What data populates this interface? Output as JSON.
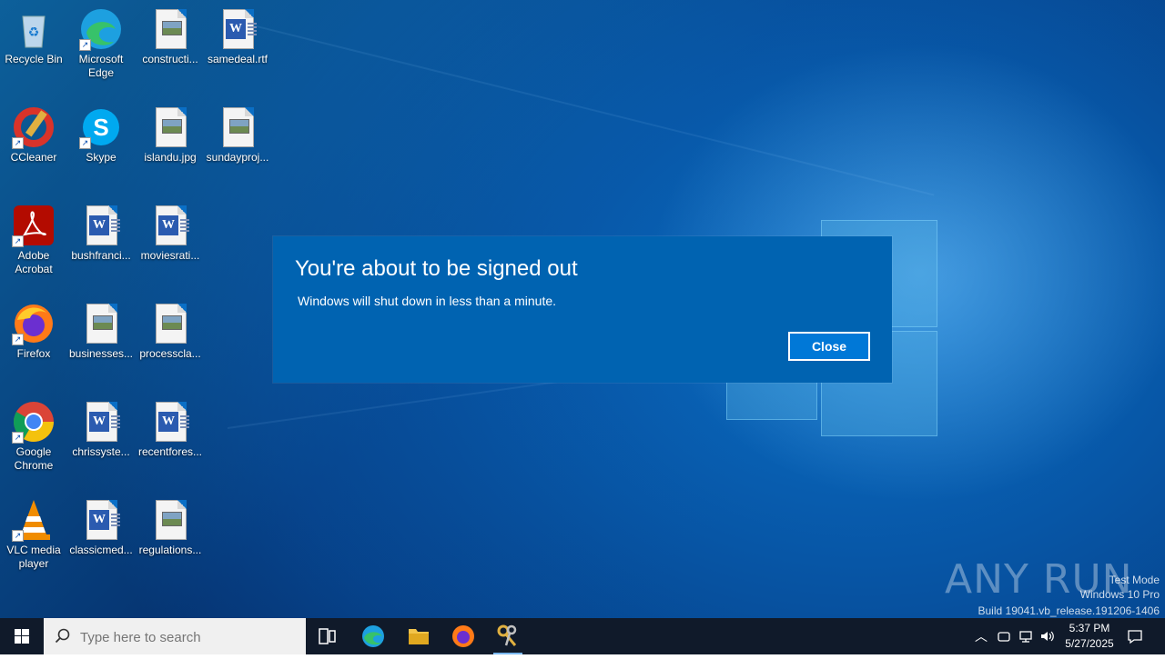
{
  "desktop_icons": [
    {
      "label": "Recycle Bin"
    },
    {
      "label": "Microsoft Edge"
    },
    {
      "label": "constructi..."
    },
    {
      "label": "samedeal.rtf"
    },
    {
      "label": "CCleaner"
    },
    {
      "label": "Skype"
    },
    {
      "label": "islandu.jpg"
    },
    {
      "label": "sundayproj..."
    },
    {
      "label": "Adobe Acrobat"
    },
    {
      "label": "bushfranci..."
    },
    {
      "label": "moviesrati..."
    },
    {
      "label": "Firefox"
    },
    {
      "label": "businesses..."
    },
    {
      "label": "processcla..."
    },
    {
      "label": "Google Chrome"
    },
    {
      "label": "chrissyste..."
    },
    {
      "label": "recentfores..."
    },
    {
      "label": "VLC media player"
    },
    {
      "label": "classicmed..."
    },
    {
      "label": "regulations..."
    }
  ],
  "dialog": {
    "title": "You're about to be signed out",
    "message": "Windows will shut down in less than a minute.",
    "close_label": "Close"
  },
  "watermark": {
    "brand": "ANY RUN",
    "line1": "Test Mode",
    "line2": "Windows 10 Pro",
    "line3": "Build 19041.vb_release.191206-1406"
  },
  "taskbar": {
    "search_placeholder": "Type here to search",
    "time": "5:37 PM",
    "date": "5/27/2025"
  },
  "colors": {
    "dialog_bg": "#0063b1",
    "button_bg": "#0078d7",
    "taskbar_bg": "#101a2a"
  }
}
